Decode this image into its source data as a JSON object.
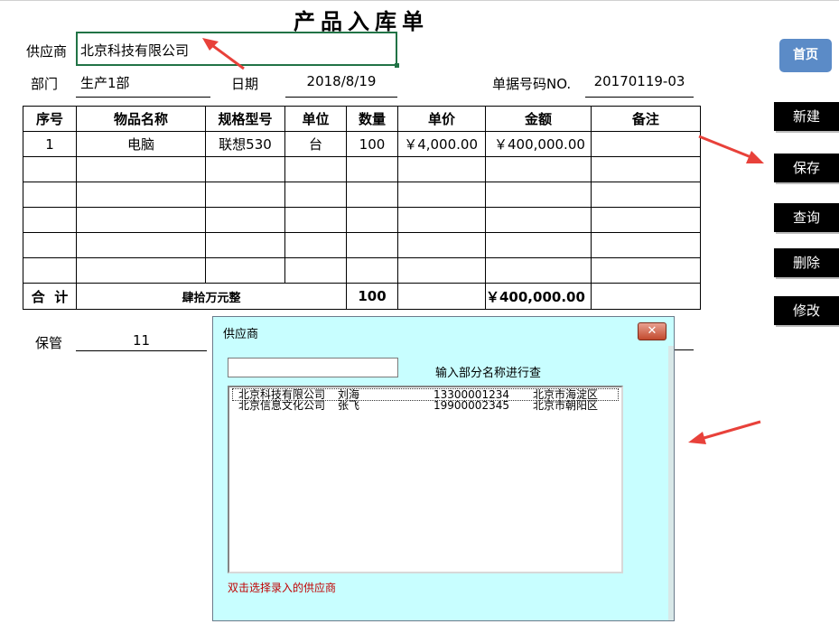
{
  "form": {
    "title": "产品入库单",
    "supplier_label": "供应商",
    "supplier_value": "北京科技有限公司",
    "dept_label": "部门",
    "dept_value": "生产1部",
    "date_label": "日期",
    "date_value": "2018/8/19",
    "doc_no_label": "单据号码NO.",
    "doc_no_value": "20170119-03",
    "keeper_label": "保管",
    "keeper_value": "11"
  },
  "table": {
    "headers": [
      "序号",
      "物品名称",
      "规格型号",
      "单位",
      "数量",
      "单价",
      "金额",
      "备注"
    ],
    "rows": [
      [
        "1",
        "电脑",
        "联想530",
        "台",
        "100",
        "￥4,000.00",
        "￥400,000.00",
        ""
      ],
      [
        "",
        "",
        "",
        "",
        "",
        "",
        "",
        ""
      ],
      [
        "",
        "",
        "",
        "",
        "",
        "",
        "",
        ""
      ],
      [
        "",
        "",
        "",
        "",
        "",
        "",
        "",
        ""
      ],
      [
        "",
        "",
        "",
        "",
        "",
        "",
        "",
        ""
      ],
      [
        "",
        "",
        "",
        "",
        "",
        "",
        "",
        ""
      ]
    ],
    "total": {
      "label": "合  计",
      "amount_words": "肆拾万元整",
      "qty": "100",
      "amount": "￥400,000.00"
    }
  },
  "buttons": {
    "home": "首页",
    "new": "新建",
    "save": "保存",
    "query": "查询",
    "delete": "删除",
    "modify": "修改"
  },
  "dialog": {
    "title": "供应商",
    "close": "✕",
    "search_value": "",
    "hint": "输入部分名称进行查",
    "suppliers": [
      {
        "name": "北京科技有限公司",
        "contact": "刘海",
        "phone": "13300001234",
        "area": "北京市海淀区"
      },
      {
        "name": "北京信息文化公司",
        "contact": "张飞",
        "phone": "19900002345",
        "area": "北京市朝阳区"
      }
    ],
    "footer": "双击选择录入的供应商"
  },
  "colors": {
    "arrow": "#e8413a",
    "dialog_bg": "#c8feff",
    "selection_border": "#217346",
    "home_button": "#5b8bc7"
  }
}
